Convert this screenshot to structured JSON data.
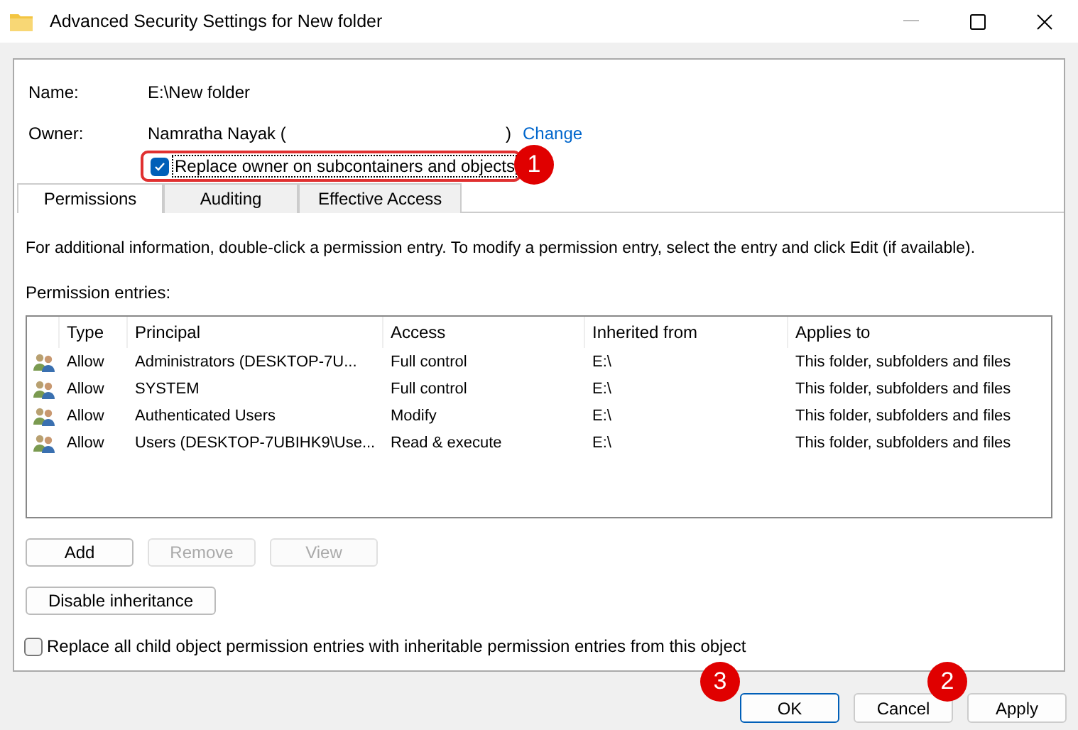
{
  "window": {
    "title": "Advanced Security Settings for New folder"
  },
  "name": {
    "label": "Name:",
    "value": "E:\\New folder"
  },
  "owner": {
    "label": "Owner:",
    "value": "Namratha Nayak (",
    "close": ")",
    "link": "Change"
  },
  "replace_owner": {
    "label": "Replace owner on subcontainers and objects",
    "checked": true,
    "annotation": "1"
  },
  "tabs": [
    {
      "label": "Permissions",
      "selected": true
    },
    {
      "label": "Auditing",
      "selected": false
    },
    {
      "label": "Effective Access",
      "selected": false
    }
  ],
  "info": "For additional information, double-click a permission entry. To modify a permission entry, select the entry and click Edit (if available).",
  "entries_label": "Permission entries:",
  "table": {
    "columns": [
      "Type",
      "Principal",
      "Access",
      "Inherited from",
      "Applies to"
    ],
    "rows": [
      {
        "cells": [
          "Allow",
          "Administrators (DESKTOP-7U...",
          "Full control",
          "E:\\",
          "This folder, subfolders and files"
        ]
      },
      {
        "cells": [
          "Allow",
          "SYSTEM",
          "Full control",
          "E:\\",
          "This folder, subfolders and files"
        ]
      },
      {
        "cells": [
          "Allow",
          "Authenticated Users",
          "Modify",
          "E:\\",
          "This folder, subfolders and files"
        ]
      },
      {
        "cells": [
          "Allow",
          "Users (DESKTOP-7UBIHK9\\Use...",
          "Read & execute",
          "E:\\",
          "This folder, subfolders and files"
        ]
      }
    ]
  },
  "entry_buttons": [
    {
      "label": "Add",
      "disabled": false
    },
    {
      "label": "Remove",
      "disabled": true
    },
    {
      "label": "View",
      "disabled": true
    }
  ],
  "inheritance_button": "Disable inheritance",
  "replace_child": {
    "label": "Replace all child object permission entries with inheritable permission entries from this object",
    "checked": false
  },
  "footer_buttons": [
    {
      "label": "OK",
      "default": true,
      "annotation": "3"
    },
    {
      "label": "Cancel",
      "default": false
    },
    {
      "label": "Apply",
      "default": false,
      "annotation": "2"
    }
  ]
}
